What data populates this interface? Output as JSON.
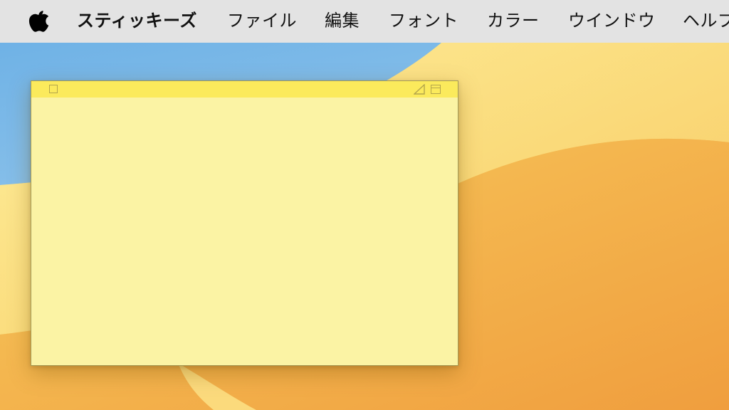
{
  "menubar": {
    "apple_icon": "apple-logo-icon",
    "app_name": "スティッキーズ",
    "items": [
      {
        "label": "ファイル"
      },
      {
        "label": "編集"
      },
      {
        "label": "フォント"
      },
      {
        "label": "カラー"
      },
      {
        "label": "ウインドウ"
      },
      {
        "label": "ヘルプ"
      }
    ]
  },
  "sticky_note": {
    "color": "#fbf3a4",
    "titlebar_color": "#fbea5c",
    "body_text": ""
  }
}
